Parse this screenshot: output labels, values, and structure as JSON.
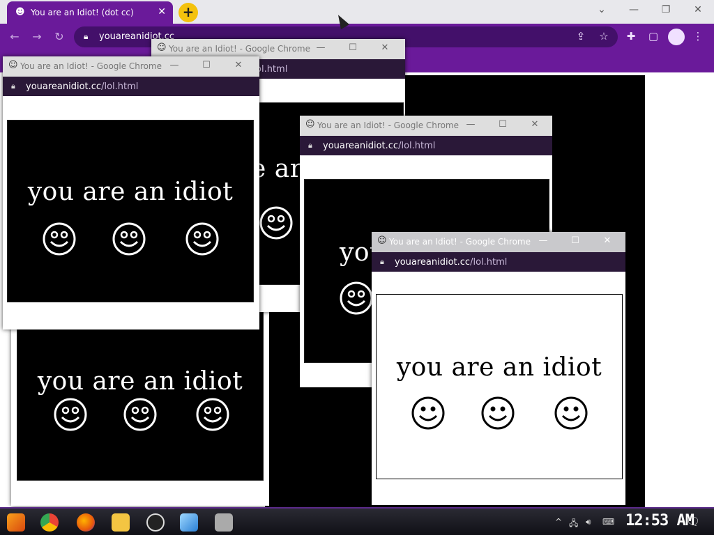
{
  "main_browser": {
    "tab_title": "You are an Idiot! (dot cc)",
    "tab_favicon": "smiley-icon",
    "url": "youareanidiot.cc",
    "new_tab_symbol": "+",
    "close_symbol": "✕"
  },
  "popups": [
    {
      "title": "You are an Idiot! - Google Chrome",
      "url_host": "youareanidiot.cc",
      "url_path": "/lol.html",
      "text": "you are an idiot",
      "theme": "black"
    },
    {
      "title": "You are an Idiot! - Google Chrome",
      "url_host": "youareanidiot.cc",
      "url_path": "/lol.html",
      "text": "you are an idiot",
      "theme": "black"
    },
    {
      "title": "You are an Idiot! - Google Chrome",
      "url_host": "youareanidiot.cc",
      "url_path": "/lol.html",
      "text": "you are an idiot",
      "theme": "black"
    },
    {
      "title": "You are an Idiot! - Google Chrome",
      "url_host": "youareanidiot.cc",
      "url_path": "/lol.html",
      "text": "you are an idiot",
      "theme": "white"
    },
    {
      "title": "",
      "url_host": "",
      "url_path": "ol.html",
      "text": "e ar",
      "theme": "black"
    },
    {
      "title": "",
      "url_host": "",
      "url_path": "",
      "text": "you are an idiot",
      "theme": "black"
    }
  ],
  "background_text": {
    "partial": "you"
  },
  "taskbar": {
    "apps": [
      "start-icon",
      "chrome-icon",
      "firefox-icon",
      "files-icon",
      "obs-icon",
      "app-icon",
      "screenshot-icon"
    ],
    "clock": "12:53 AM"
  },
  "colors": {
    "accent": "#6a1a9a",
    "popup_dark": "#2a1838",
    "titlebar": "#dedede"
  }
}
